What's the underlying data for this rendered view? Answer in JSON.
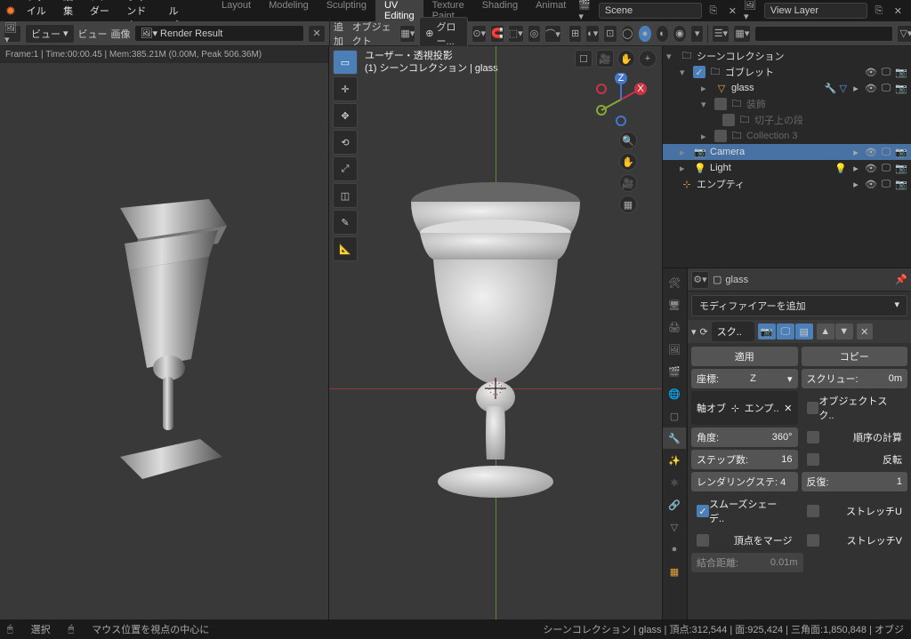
{
  "menu": {
    "file": "ファイル",
    "edit": "編集",
    "render": "レンダー",
    "window": "ウィンドウ",
    "help": "ヘルプ"
  },
  "workspaces": {
    "layout": "Layout",
    "modeling": "Modeling",
    "sculpting": "Sculpting",
    "uv": "UV Editing",
    "texture": "Texture Paint",
    "shading": "Shading",
    "anim": "Animat"
  },
  "scene": {
    "label": "Scene",
    "viewlayer": "View Layer"
  },
  "hdr_left": {
    "view": "ビュー",
    "view2": "ビュー",
    "image": "画像",
    "render_result": "Render Result"
  },
  "render_info": "Frame:1 | Time:00:00.45 | Mem:385.21M (0.00M, Peak 506.36M)",
  "hdr_mid": {
    "add": "追加",
    "object": "オブジェクト",
    "global": "グロー..."
  },
  "view3d_info": {
    "l1": "ユーザー・透視投影",
    "l2": "(1) シーンコレクション | glass"
  },
  "outliner": {
    "scene_coll": "シーンコレクション",
    "goblet": "ゴブレット",
    "glass": "glass",
    "decoration": "装飾",
    "kiriko": "切子上の段",
    "coll3": "Collection 3",
    "camera": "Camera",
    "light": "Light",
    "empty": "エンプティ"
  },
  "props": {
    "obj": "glass",
    "add_modifier": "モディファイアーを追加",
    "mod_name": "スク..",
    "apply": "適用",
    "copy": "コピー",
    "coord_label": "座標:",
    "coord_val": "Z",
    "screw_label": "スクリュー:",
    "screw_val": "0m",
    "axis_obj_label": "軸オブ",
    "axis_obj_val": "エンプ..",
    "obj_screw": "オブジェクトスク..",
    "angle_label": "角度:",
    "angle_val": "360°",
    "calc_order": "順序の計算",
    "steps_label": "ステップ数:",
    "steps_val": "16",
    "flip": "反転",
    "render_steps": "レンダリングステ: 4",
    "iterations_label": "反復:",
    "iterations_val": "1",
    "smooth_shade": "スムーズシェーデ..",
    "stretch_u": "ストレッチU",
    "merge_verts": "頂点をマージ",
    "stretch_v": "ストレッチV",
    "merge_dist_label": "結合距離:",
    "merge_dist_val": "0.01m"
  },
  "status": {
    "select": "選択",
    "center": "マウス位置を視点の中心に",
    "stats": "シーンコレクション | glass | 頂点:312,544 | 面:925,424 | 三角面:1,850,848 | オブジ"
  }
}
